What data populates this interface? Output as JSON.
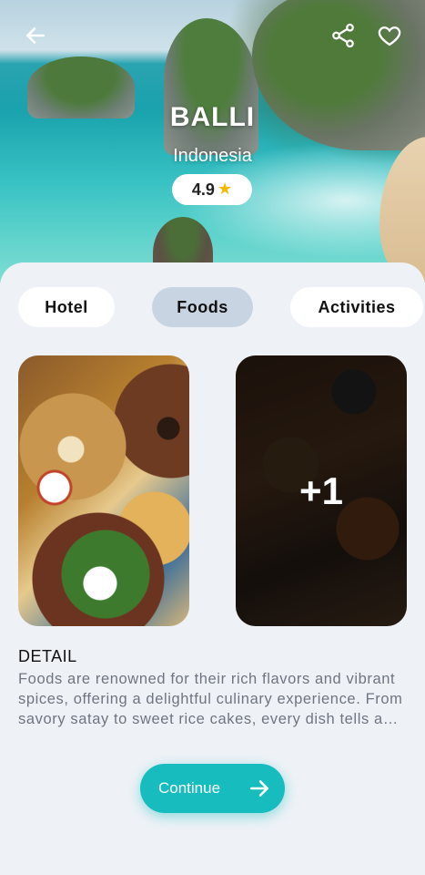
{
  "header": {
    "title": "BALLI",
    "country": "Indonesia",
    "rating": "4.9",
    "icons": [
      "back-arrow-icon",
      "share-icon",
      "heart-icon",
      "star-icon"
    ]
  },
  "tabs": [
    {
      "label": "Hotel",
      "active": false
    },
    {
      "label": "Foods",
      "active": true
    },
    {
      "label": "Activities",
      "active": false
    }
  ],
  "gallery": {
    "more_count": "+1"
  },
  "detail": {
    "heading": "DETAIL",
    "text": "Foods are renowned for their rich flavors and vibrant spices, offering a delightful culinary experience. From savory satay to sweet rice cakes, every dish tells a story."
  },
  "cta": {
    "label": "Continue"
  },
  "colors": {
    "accent": "#17bdbe",
    "active_tab": "#c9d4e3",
    "background": "#eef2f7",
    "star": "#f5b800"
  }
}
